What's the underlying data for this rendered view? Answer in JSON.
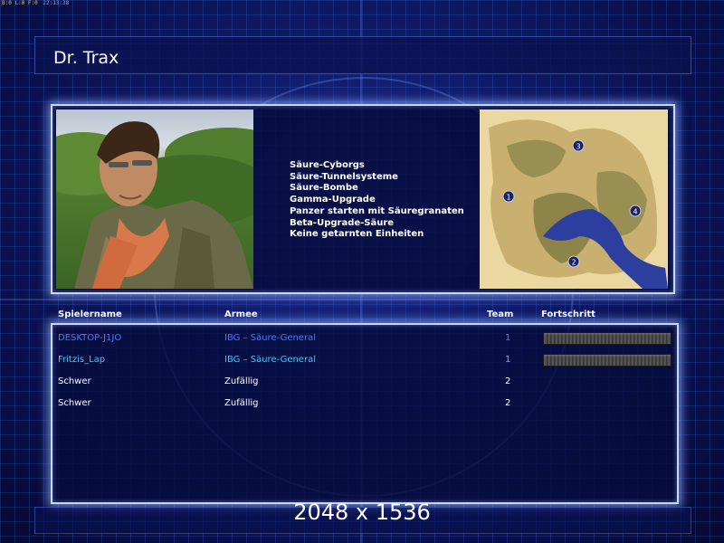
{
  "system_bar": {
    "text_left": "B:0 L:0 F:0",
    "clock": "22:13:38"
  },
  "window": {
    "title": "Dr. Trax"
  },
  "general": {
    "features": [
      "Säure-Cyborgs",
      "Säure-Tunnelsysteme",
      "Säure-Bombe",
      "Gamma-Upgrade",
      "Panzer starten mit Säuregranaten",
      "Beta-Upgrade-Säure",
      "Keine getarnten Einheiten"
    ]
  },
  "map": {
    "start_positions": [
      "1",
      "2",
      "3",
      "4"
    ],
    "colors": {
      "sand": "#e6cf95",
      "water": "#2d3f9e",
      "grass": "#9a8f52"
    }
  },
  "players": {
    "headers": {
      "name": "Spielername",
      "army": "Armee",
      "team": "Team",
      "progress": "Fortschritt"
    },
    "rows": [
      {
        "name": "DESKTOP-J1JO",
        "army": "IBG – Säure-General",
        "team": "1",
        "progress": 0,
        "color": "#4a78ff"
      },
      {
        "name": "Fritzis_Lap",
        "army": "IBG – Säure-General",
        "team": "1",
        "progress": 0,
        "color": "#42c6f0"
      },
      {
        "name": "Schwer",
        "army": "Zufällig",
        "team": "2",
        "progress": null,
        "color": "#ffffff"
      },
      {
        "name": "Schwer",
        "army": "Zufällig",
        "team": "2",
        "progress": null,
        "color": "#ffffff"
      }
    ]
  },
  "overlay": {
    "resolution": "2048 x 1536"
  },
  "colors": {
    "panel_border": "#c9d8ff",
    "background": "#0f1a66"
  }
}
